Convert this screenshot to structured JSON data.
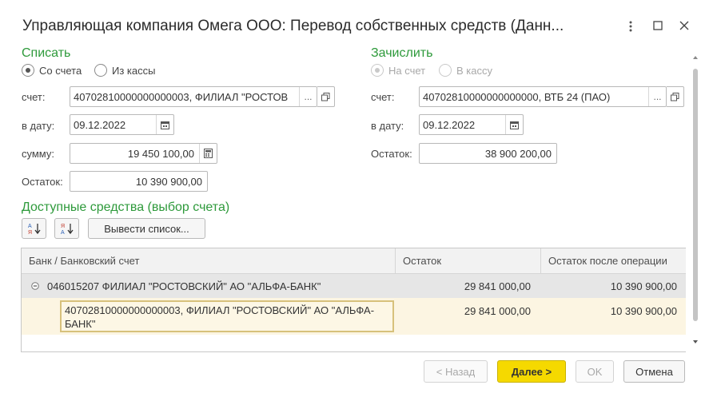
{
  "window": {
    "title": "Управляющая компания Омега ООО: Перевод собственных средств (Данн...",
    "icons": [
      "more-icon",
      "maximize-icon",
      "close-icon"
    ]
  },
  "debit": {
    "title": "Списать",
    "radio_account": "Со счета",
    "radio_cash": "Из кассы",
    "account_label": "счет:",
    "account_value": "40702810000000000003, ФИЛИАЛ \"РОСТОВ",
    "date_label": "в дату:",
    "date_value": "09.12.2022",
    "sum_label": "сумму:",
    "sum_value": "19 450 100,00",
    "balance_label": "Остаток:",
    "balance_value": "10 390 900,00"
  },
  "credit": {
    "title": "Зачислить",
    "radio_account": "На счет",
    "radio_cash": "В кассу",
    "account_label": "счет:",
    "account_value": "40702810000000000000, ВТБ 24 (ПАО)",
    "date_label": "в дату:",
    "date_value": "09.12.2022",
    "balance_label": "Остаток:",
    "balance_value": "38 900 200,00"
  },
  "available": {
    "title": "Доступные средства (выбор счета)",
    "list_button": "Вывести список..."
  },
  "table": {
    "headers": [
      "Банк / Банковский счет",
      "Остаток",
      "Остаток после операции"
    ],
    "group": {
      "name": "046015207 ФИЛИАЛ \"РОСТОВСКИЙ\" АО \"АЛЬФА-БАНК\"",
      "balance": "29 841 000,00",
      "after": "10 390 900,00"
    },
    "row": {
      "account": "40702810000000000003, ФИЛИАЛ \"РОСТОВСКИЙ\" АО \"АЛЬФА-БАНК\"",
      "balance": "29 841 000,00",
      "after": "10 390 900,00"
    }
  },
  "buttons": {
    "back": "< Назад",
    "next": "Далее >",
    "ok": "OK",
    "cancel": "Отмена"
  },
  "colors": {
    "accent_green": "#2e9a3b",
    "primary_button": "#f5d900",
    "selected_row": "#fcf5e2"
  }
}
